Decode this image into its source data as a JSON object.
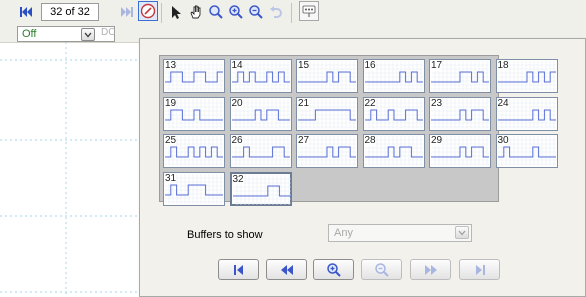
{
  "toolbar": {
    "page_indicator": "32 of 32",
    "icons": [
      "first-frame-icon",
      "next-frame-icon",
      "compass-icon",
      "pointer-icon",
      "hand-icon",
      "zoom-icon",
      "zoom-in-icon",
      "zoom-out-icon",
      "undo-icon",
      "inspect-icon"
    ]
  },
  "coupling": {
    "selected": "Off",
    "dc_label": "DC"
  },
  "buffers": {
    "thumbnails": [
      {
        "label": "13",
        "pattern": [
          0,
          1,
          1,
          0,
          0,
          1,
          1,
          0,
          0,
          1
        ]
      },
      {
        "label": "14",
        "pattern": [
          0,
          1,
          0,
          1,
          0,
          0,
          1,
          0,
          1,
          0
        ]
      },
      {
        "label": "15",
        "pattern": [
          0,
          0,
          0,
          0,
          0,
          1,
          0,
          1,
          1,
          0
        ]
      },
      {
        "label": "16",
        "pattern": [
          0,
          0,
          0,
          0,
          0,
          0,
          1,
          0,
          1,
          0
        ]
      },
      {
        "label": "17",
        "pattern": [
          0,
          0,
          0,
          0,
          0,
          1,
          1,
          0,
          1,
          0
        ]
      },
      {
        "label": "18",
        "pattern": [
          0,
          0,
          0,
          0,
          0,
          1,
          0,
          1,
          0,
          1
        ]
      },
      {
        "label": "19",
        "pattern": [
          0,
          1,
          1,
          0,
          0,
          1,
          0,
          0,
          0,
          0
        ]
      },
      {
        "label": "20",
        "pattern": [
          0,
          0,
          0,
          0,
          1,
          0,
          1,
          1,
          0,
          0
        ]
      },
      {
        "label": "21",
        "pattern": [
          0,
          0,
          0,
          1,
          1,
          1,
          1,
          1,
          1,
          0
        ]
      },
      {
        "label": "22",
        "pattern": [
          0,
          1,
          0,
          0,
          1,
          0,
          0,
          1,
          1,
          0
        ]
      },
      {
        "label": "23",
        "pattern": [
          0,
          0,
          0,
          0,
          0,
          1,
          0,
          1,
          1,
          0
        ]
      },
      {
        "label": "24",
        "pattern": [
          0,
          0,
          0,
          0,
          0,
          0,
          1,
          0,
          1,
          0
        ]
      },
      {
        "label": "25",
        "pattern": [
          0,
          1,
          0,
          0,
          1,
          0,
          1,
          0,
          1,
          0
        ]
      },
      {
        "label": "26",
        "pattern": [
          0,
          0,
          1,
          0,
          0,
          0,
          0,
          1,
          1,
          0
        ]
      },
      {
        "label": "27",
        "pattern": [
          0,
          0,
          0,
          0,
          0,
          1,
          0,
          1,
          1,
          0
        ]
      },
      {
        "label": "28",
        "pattern": [
          0,
          0,
          0,
          0,
          1,
          0,
          1,
          1,
          0,
          0
        ]
      },
      {
        "label": "29",
        "pattern": [
          0,
          0,
          0,
          0,
          0,
          1,
          0,
          1,
          1,
          0
        ]
      },
      {
        "label": "30",
        "pattern": [
          0,
          1,
          0,
          0,
          0,
          0,
          1,
          0,
          0,
          0
        ]
      },
      {
        "label": "31",
        "pattern": [
          0,
          1,
          0,
          0,
          1,
          1,
          1,
          0,
          0,
          0
        ]
      },
      {
        "label": "32",
        "pattern": [
          0,
          0,
          0,
          0,
          0,
          0,
          1,
          1,
          0,
          0
        ]
      }
    ],
    "selected_index": 19,
    "filter_label": "Buffers to show",
    "filter_value": "Any"
  },
  "colors": {
    "waveform": "#5a6fd6",
    "thumb_grid": "#e6ecf4",
    "panel": "#c8c8c8",
    "nav_icon": "#3b56c9",
    "nav_icon_disabled": "#a9b6e0"
  },
  "nav_buttons": [
    {
      "name": "first-buffer-button",
      "icon": "first-icon",
      "enabled": true
    },
    {
      "name": "previous-buffer-button",
      "icon": "previous-icon",
      "enabled": true
    },
    {
      "name": "zoom-buffer-button",
      "icon": "zoom-in-icon",
      "enabled": true
    },
    {
      "name": "zoom-out-buffer-button",
      "icon": "zoom-out-icon",
      "enabled": false
    },
    {
      "name": "next-buffer-button",
      "icon": "next-icon",
      "enabled": false
    },
    {
      "name": "last-buffer-button",
      "icon": "last-icon",
      "enabled": false
    }
  ]
}
